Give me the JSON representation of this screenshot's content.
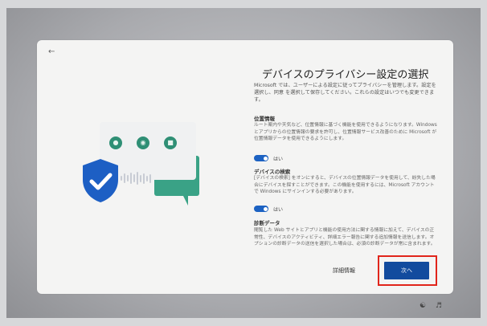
{
  "dialog": {
    "title": "デバイスのプライバシー設定の選択",
    "intro": "Microsoft では、ユーザーによる設定に従ってプライバシーを管理します。設定を選択し、同意 を選択して保存してください。これらの設定はいつでも変更できます。",
    "sections": [
      {
        "heading": "位置情報",
        "text": "ルート案内や天気など、位置情報に基づく機能を使用できるようになります。Windows とアプリからの位置情報の要求を許可し、位置情報サービス改善のために Microsoft が位置情報データを使用できるようにします。",
        "toggle_label": "はい"
      },
      {
        "heading": "デバイスの検索",
        "text": "[デバイスの検索] をオンにすると、デバイスの位置情報データを使用して、紛失した場合にデバイスを探すことができます。この機能を使用するには、Microsoft アカウントで Windows にサインインする必要があります。",
        "toggle_label": "はい"
      },
      {
        "heading": "診断データ",
        "text": "閲覧した Web サイトとアプリと機能の使用方法に関する情報に加えて、デバイスの正常性、デバイスのアクティビティ、詳細エラー報告に関する追加情報を送信します。オプションの診断データの送信を選択した場合は、必須の診断データが常に含まれます。"
      }
    ],
    "details_label": "詳細情報",
    "next_label": "次へ"
  },
  "icons": {
    "back": "back-arrow-icon",
    "location": "location-pin-icon",
    "fingerprint": "fingerprint-icon",
    "lock": "lock-icon",
    "shield": "shield-check-icon",
    "accessibility": "accessibility-icon",
    "volume": "volume-icon"
  },
  "colors": {
    "accent": "#124b9e",
    "highlight": "#e1251b",
    "toggle": "#1c62c2",
    "illustration_green": "#3aa286"
  }
}
